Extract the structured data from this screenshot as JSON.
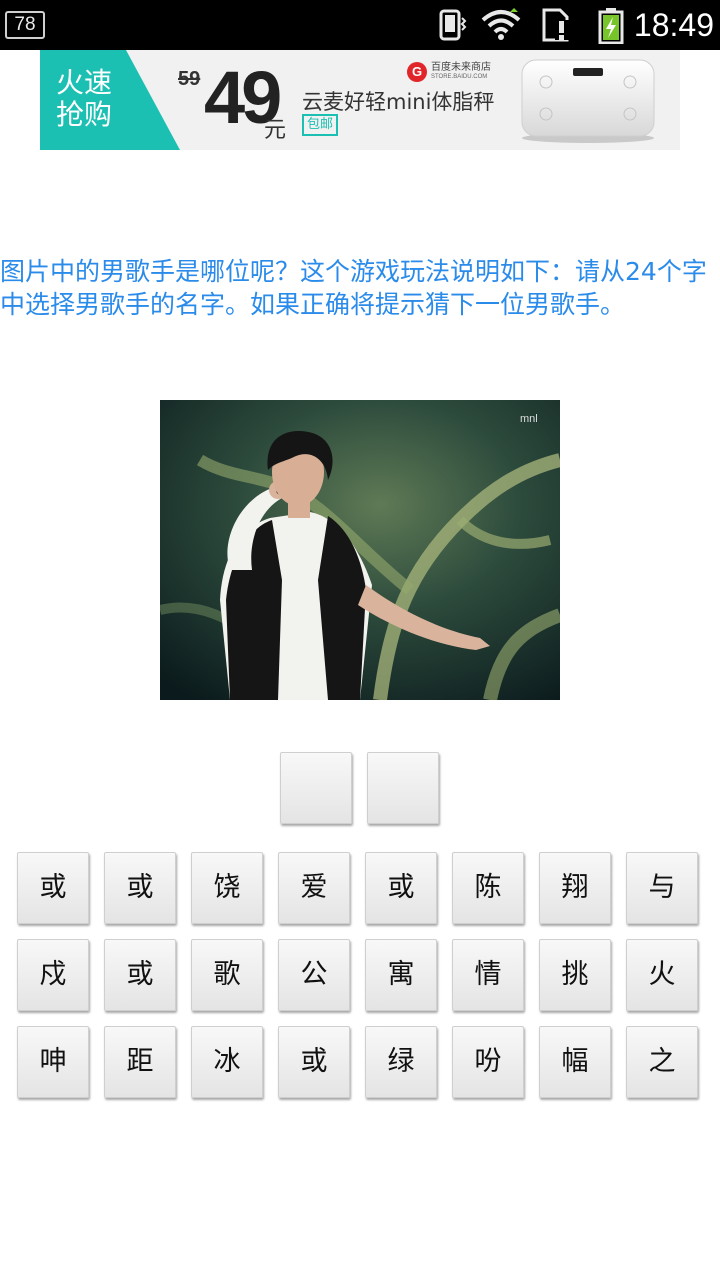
{
  "status_bar": {
    "notification_count": "78",
    "icons": [
      "vibrate-icon",
      "wifi-icon",
      "sim-alert-icon",
      "battery-charging-icon"
    ],
    "time": "18:49"
  },
  "ad": {
    "tag": "火速抢购",
    "old_price": "59",
    "price": "49",
    "currency": "元",
    "store_name": "百度未来商店",
    "store_url": "STORE.BAIDU.COM",
    "product": "云麦好轻mini体脂秤",
    "badge": "包邮",
    "accent_color": "#1cc0b2"
  },
  "question": "图片中的男歌手是哪位呢？这个游戏玩法说明如下：请从24个字中选择男歌手的名字。如果正确将提示猜下一位男歌手。",
  "answer_slots": [
    "",
    ""
  ],
  "characters": [
    [
      "或",
      "或",
      "饶",
      "爱",
      "或",
      "陈",
      "翔",
      "与"
    ],
    [
      "戍",
      "或",
      "歌",
      "公",
      "寓",
      "情",
      "挑",
      "火"
    ],
    [
      "呻",
      "距",
      "冰",
      "或",
      "绿",
      "吩",
      "幅",
      "之"
    ]
  ],
  "colors": {
    "question_text": "#2a8bea",
    "status_bar_bg": "#000000"
  }
}
